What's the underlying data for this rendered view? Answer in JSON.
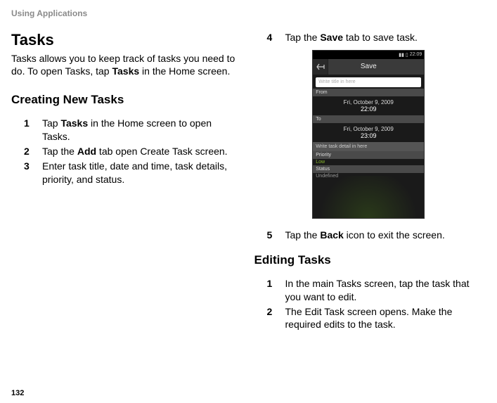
{
  "header": "Using Applications",
  "page_number": "132",
  "left": {
    "title": "Tasks",
    "intro_parts": [
      "Tasks allows you to keep track of tasks you need to do. To open Tasks, tap ",
      "Tasks",
      " in the Home screen."
    ],
    "subsection": "Creating New Tasks",
    "steps": [
      {
        "num": "1",
        "pre": "Tap ",
        "bold": "Tasks",
        "post": " in the Home screen to open Tasks."
      },
      {
        "num": "2",
        "pre": "Tap the ",
        "bold": "Add",
        "post": " tab open Create Task screen."
      },
      {
        "num": "3",
        "pre": "",
        "bold": "",
        "post": "Enter task title, date and time, task details, priority, and status."
      }
    ]
  },
  "right": {
    "step4": {
      "num": "4",
      "pre": "Tap the ",
      "bold": "Save",
      "post": " tab to save task."
    },
    "step5": {
      "num": "5",
      "pre": "Tap the ",
      "bold": "Back",
      "post": " icon to exit the screen."
    },
    "subsection": "Editing Tasks",
    "steps_edit": [
      {
        "num": "1",
        "text": "In the main Tasks screen, tap the task that you want to edit."
      },
      {
        "num": "2",
        "text": "The Edit Task screen opens. Make the required edits to the task."
      }
    ]
  },
  "phone": {
    "status_time": "22:09",
    "topbar_title": "Save",
    "title_placeholder": "Write title in here",
    "from_label": "From",
    "from_date": "Fri, October 9, 2009",
    "from_time": "22:09",
    "to_label": "To",
    "to_date": "Fri, October 9, 2009",
    "to_time": "23:09",
    "detail_placeholder": "Write task detail in here",
    "priority_label": "Priority",
    "priority_value": "Low",
    "status_label": "Status",
    "status_value": "Undefined"
  }
}
